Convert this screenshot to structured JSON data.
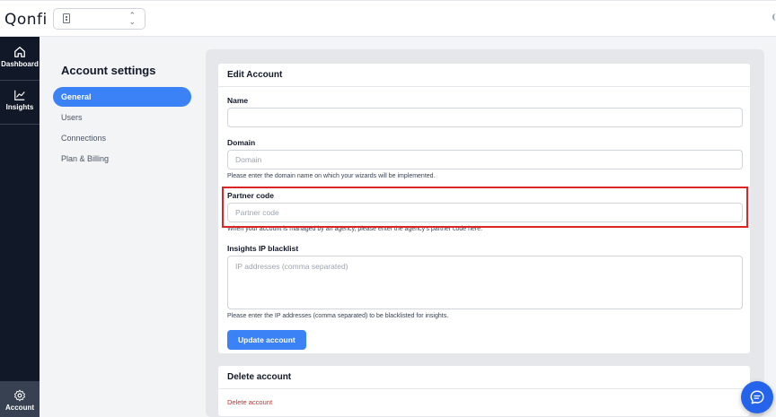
{
  "app": {
    "logo_text": "Qonfi"
  },
  "topbar": {
    "workspace_value": ""
  },
  "nav": {
    "dashboard_label": "Dashboard",
    "insights_label": "Insights",
    "account_label": "Account"
  },
  "settings": {
    "title": "Account settings",
    "menu": [
      {
        "label": "General",
        "active": true
      },
      {
        "label": "Users",
        "active": false
      },
      {
        "label": "Connections",
        "active": false
      },
      {
        "label": "Plan & Billing",
        "active": false
      }
    ]
  },
  "edit_account": {
    "title": "Edit Account",
    "name": {
      "label": "Name",
      "value": "",
      "placeholder": ""
    },
    "domain": {
      "label": "Domain",
      "value": "",
      "placeholder": "Domain",
      "help": "Please enter the domain name on which your wizards will be implemented."
    },
    "partner_code": {
      "label": "Partner code",
      "value": "",
      "placeholder": "Partner code",
      "help": "When your account is managed by an agency, please enter the agency's partner code here."
    },
    "ip_blacklist": {
      "label": "Insights IP blacklist",
      "value": "",
      "placeholder": "IP addresses (comma separated)",
      "help": "Please enter the IP addresses (comma separated) to be blacklisted for insights."
    },
    "submit_label": "Update account"
  },
  "delete_account": {
    "title": "Delete account",
    "link_label": "Delete account"
  },
  "colors": {
    "accent": "#3b82f6",
    "rail": "#111827",
    "danger": "#dc2626",
    "highlight_box": "#dc2626"
  }
}
